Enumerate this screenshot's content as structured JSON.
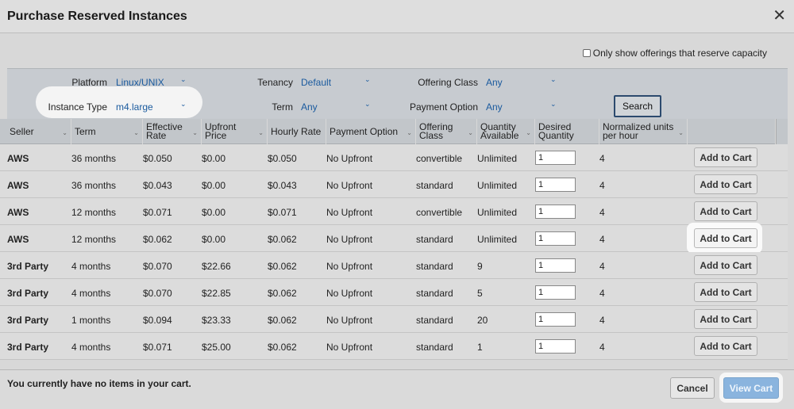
{
  "dialog": {
    "title": "Purchase Reserved Instances",
    "close_glyph": "✕"
  },
  "reserve_option": {
    "label": "Only show offerings that reserve capacity"
  },
  "filters": {
    "platform": {
      "label": "Platform",
      "value": "Linux/UNIX"
    },
    "tenancy": {
      "label": "Tenancy",
      "value": "Default"
    },
    "offering_class": {
      "label": "Offering Class",
      "value": "Any"
    },
    "instance_type": {
      "label": "Instance Type",
      "value": "m4.large"
    },
    "term": {
      "label": "Term",
      "value": "Any"
    },
    "payment_option": {
      "label": "Payment Option",
      "value": "Any"
    },
    "search_label": "Search",
    "chevron_glyph": "⌄"
  },
  "columns": {
    "seller": "Seller",
    "term": "Term",
    "effective_rate_1": "Effective",
    "effective_rate_2": "Rate",
    "upfront_price_1": "Upfront",
    "upfront_price_2": "Price",
    "hourly_rate": "Hourly Rate",
    "payment_option": "Payment Option",
    "offering_class_1": "Offering",
    "offering_class_2": "Class",
    "qty_available_1": "Quantity",
    "qty_available_2": "Available",
    "desired_qty_1": "Desired",
    "desired_qty_2": "Quantity",
    "normalized_1": "Normalized units",
    "normalized_2": "per hour",
    "sort_glyph": "⌄"
  },
  "rows": [
    {
      "seller": "AWS",
      "term": "36 months",
      "effective_rate": "$0.050",
      "upfront_price": "$0.00",
      "hourly_rate": "$0.050",
      "payment_option": "No Upfront",
      "offering_class": "convertible",
      "qty_available": "Unlimited",
      "desired_qty": "1",
      "normalized": "4",
      "action": "Add to Cart"
    },
    {
      "seller": "AWS",
      "term": "36 months",
      "effective_rate": "$0.043",
      "upfront_price": "$0.00",
      "hourly_rate": "$0.043",
      "payment_option": "No Upfront",
      "offering_class": "standard",
      "qty_available": "Unlimited",
      "desired_qty": "1",
      "normalized": "4",
      "action": "Add to Cart"
    },
    {
      "seller": "AWS",
      "term": "12 months",
      "effective_rate": "$0.071",
      "upfront_price": "$0.00",
      "hourly_rate": "$0.071",
      "payment_option": "No Upfront",
      "offering_class": "convertible",
      "qty_available": "Unlimited",
      "desired_qty": "1",
      "normalized": "4",
      "action": "Add to Cart"
    },
    {
      "seller": "AWS",
      "term": "12 months",
      "effective_rate": "$0.062",
      "upfront_price": "$0.00",
      "hourly_rate": "$0.062",
      "payment_option": "No Upfront",
      "offering_class": "standard",
      "qty_available": "Unlimited",
      "desired_qty": "1",
      "normalized": "4",
      "action": "Add to Cart"
    },
    {
      "seller": "3rd Party",
      "term": "4 months",
      "effective_rate": "$0.070",
      "upfront_price": "$22.66",
      "hourly_rate": "$0.062",
      "payment_option": "No Upfront",
      "offering_class": "standard",
      "qty_available": "9",
      "desired_qty": "1",
      "normalized": "4",
      "action": "Add to Cart"
    },
    {
      "seller": "3rd Party",
      "term": "4 months",
      "effective_rate": "$0.070",
      "upfront_price": "$22.85",
      "hourly_rate": "$0.062",
      "payment_option": "No Upfront",
      "offering_class": "standard",
      "qty_available": "5",
      "desired_qty": "1",
      "normalized": "4",
      "action": "Add to Cart"
    },
    {
      "seller": "3rd Party",
      "term": "1 months",
      "effective_rate": "$0.094",
      "upfront_price": "$23.33",
      "hourly_rate": "$0.062",
      "payment_option": "No Upfront",
      "offering_class": "standard",
      "qty_available": "20",
      "desired_qty": "1",
      "normalized": "4",
      "action": "Add to Cart"
    },
    {
      "seller": "3rd Party",
      "term": "4 months",
      "effective_rate": "$0.071",
      "upfront_price": "$25.00",
      "hourly_rate": "$0.062",
      "payment_option": "No Upfront",
      "offering_class": "standard",
      "qty_available": "1",
      "desired_qty": "1",
      "normalized": "4",
      "action": "Add to Cart"
    }
  ],
  "footer": {
    "cart_message": "You currently have no items in your cart.",
    "cancel_label": "Cancel",
    "view_cart_label": "View Cart"
  },
  "colors": {
    "accent_link": "#1a5a9e",
    "view_cart_button": "#8ab4de",
    "search_border": "#2c4a6e"
  }
}
